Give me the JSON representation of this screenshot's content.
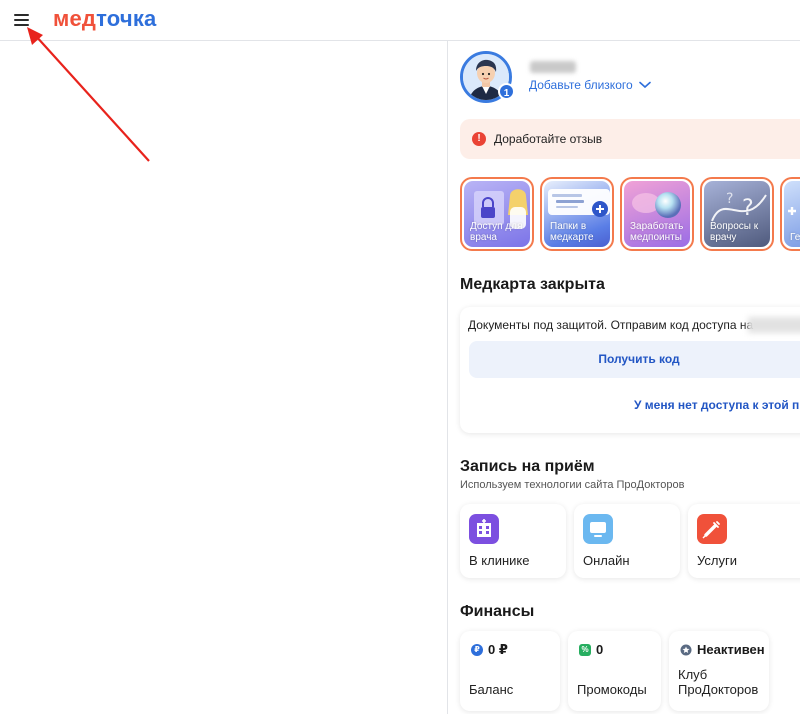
{
  "header": {
    "logo_part1": "мед",
    "logo_part2": "точка"
  },
  "profile": {
    "badge_count": "1",
    "add_relative": "Добавьте близкого"
  },
  "notice": {
    "icon": "!",
    "text": "Доработайте отзыв"
  },
  "stories": [
    {
      "label": "Доступ для врача"
    },
    {
      "label": "Папки в медкарте"
    },
    {
      "label": "Заработать медпоинты"
    },
    {
      "label": "Вопросы к врачу"
    },
    {
      "label": "Ге... вр..."
    }
  ],
  "medcard": {
    "title": "Медкарта закрыта",
    "text": "Документы под защитой. Отправим код доступа на",
    "get_code_button": "Получить код",
    "no_access_link": "У меня нет доступа к этой п"
  },
  "appointment": {
    "title": "Запись на приём",
    "subtitle": "Используем технологии сайта ПроДокторов",
    "tiles": [
      {
        "label": "В клинике",
        "icon": "hospital-icon",
        "color": "#7c4fe0"
      },
      {
        "label": "Онлайн",
        "icon": "monitor-icon",
        "color": "#6bb8f0"
      },
      {
        "label": "Услуги",
        "icon": "syringe-icon",
        "color": "#f0513a"
      }
    ]
  },
  "finance": {
    "title": "Финансы",
    "balance_value": "0 ₽",
    "balance_label": "Баланс",
    "promo_value": "0",
    "promo_label": "Промокоды",
    "club_value": "Неактивен",
    "club_label_line1": "Клуб",
    "club_label_line2": "ПроДокторов"
  },
  "colors": {
    "brand_red": "#f0513a",
    "brand_blue": "#2e6fdb",
    "link_blue": "#2256c4",
    "notice_bg": "#fdeee8"
  }
}
